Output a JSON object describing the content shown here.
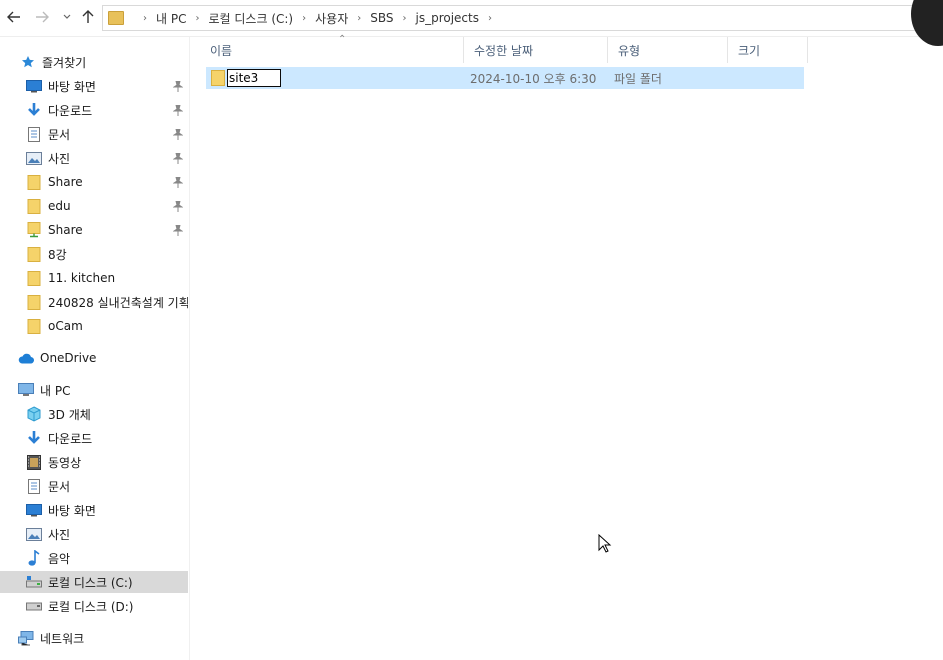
{
  "toolbar": {
    "back_icon": "back-arrow-icon",
    "forward_icon": "forward-arrow-icon",
    "recent_icon": "chevron-down-icon",
    "up_icon": "up-arrow-icon"
  },
  "breadcrumb": [
    "내 PC",
    "로컬 디스크 (C:)",
    "사용자",
    "SBS",
    "js_projects"
  ],
  "sidebar": {
    "quick_access": "즐겨찾기",
    "pinned": [
      {
        "label": "바탕 화면",
        "icon": "desktop-icon"
      },
      {
        "label": "다운로드",
        "icon": "download-icon"
      },
      {
        "label": "문서",
        "icon": "document-icon"
      },
      {
        "label": "사진",
        "icon": "pictures-icon"
      },
      {
        "label": "Share",
        "icon": "folder-icon"
      },
      {
        "label": "edu",
        "icon": "folder-icon"
      },
      {
        "label": "Share",
        "icon": "network-folder-icon"
      }
    ],
    "recent": [
      {
        "label": "8강",
        "icon": "folder-icon"
      },
      {
        "label": "11. kitchen",
        "icon": "folder-icon"
      },
      {
        "label": "240828 실내건축설계 기획",
        "icon": "folder-icon"
      },
      {
        "label": "oCam",
        "icon": "folder-icon"
      }
    ],
    "onedrive": "OneDrive",
    "this_pc": "내 PC",
    "pc_items": [
      {
        "label": "3D 개체",
        "icon": "3d-objects-icon"
      },
      {
        "label": "다운로드",
        "icon": "download-icon"
      },
      {
        "label": "동영상",
        "icon": "video-icon"
      },
      {
        "label": "문서",
        "icon": "document-icon"
      },
      {
        "label": "바탕 화면",
        "icon": "desktop-icon"
      },
      {
        "label": "사진",
        "icon": "pictures-icon"
      },
      {
        "label": "음악",
        "icon": "music-icon"
      },
      {
        "label": "로컬 디스크 (C:)",
        "icon": "drive-icon"
      },
      {
        "label": "로컬 디스크 (D:)",
        "icon": "drive-icon"
      }
    ],
    "network": "네트워크"
  },
  "columns": {
    "name": "이름",
    "date": "수정한 날짜",
    "type": "유형",
    "size": "크기"
  },
  "files": [
    {
      "name": "site3",
      "date": "2024-10-10 오후 6:30",
      "type": "파일 폴더",
      "size": ""
    }
  ],
  "colors": {
    "selection": "#cce8ff",
    "sidebar_selected": "#d9d9d9",
    "folder": "#e8c15a",
    "header_text": "#4c607a"
  }
}
